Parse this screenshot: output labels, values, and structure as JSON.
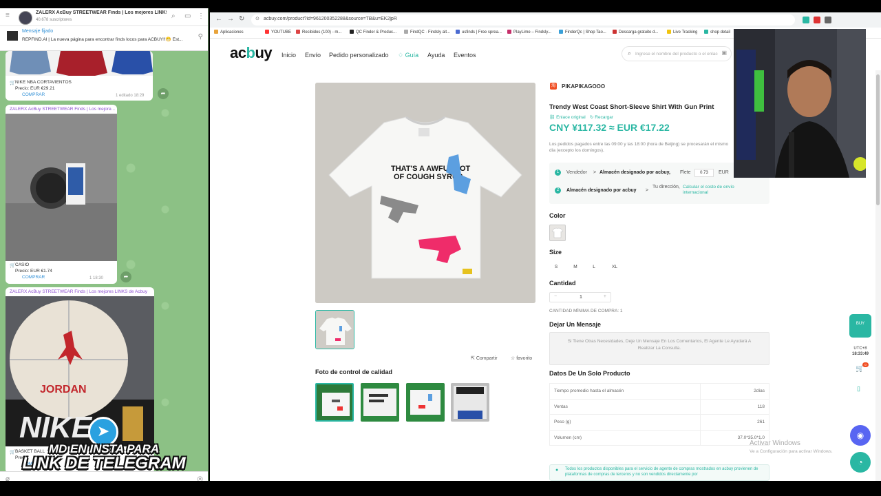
{
  "telegram": {
    "channel_title": "ZALERX AcBuy STREETWEAR Finds | Los mejores LINKS de Ac...",
    "subscribers": "40.678 suscriptores",
    "pinned_label": "Mensaje fijado",
    "pinned_text": "REPFIND.AI | La nueva página para encontrar finds locos para ACBUY!!😁 Est...",
    "msg1": {
      "icon": "🛒",
      "product": "NIKE NBA CORTAVIENTOS",
      "price": "Precio: EUR €29.21",
      "link": "COMPRAR",
      "meta": "1  editado 18:29"
    },
    "msg2": {
      "source": "ZALERX AcBuy STREETWEAR Finds | Los mejore...",
      "product": "CASIO",
      "price": "Precio: EUR €1.74",
      "link": "COMPRAR",
      "meta": "1  18:30"
    },
    "msg3": {
      "source": "ZALERX AcBuy STREETWEAR Finds | Los mejores LINKS de Acbuy",
      "product": "BASKET BALL",
      "price": "Precio:",
      "link": "COMPRAR"
    }
  },
  "overlay": {
    "line1": "MD EN INSTA PARA",
    "line2": "LINK DE TELEGRAM"
  },
  "browser": {
    "url": "acbuy.com/product?id=961200352288&source=TB&u=EK2jpR",
    "bookmarks": [
      "Aplicaciones",
      "YOUTUBE",
      "Recibidos (100) - m...",
      "QC Finder & Produc...",
      "FindQC · Findsly alt...",
      "usfinds | Free sprea...",
      "PlayLime – Findsly...",
      "FinderQc | Shop Tao...",
      "Descarga gratuito d...",
      "Live Tracking",
      "shop detail"
    ]
  },
  "site": {
    "logo_left": "ac",
    "logo_mid": "b",
    "logo_right": "uy",
    "nav": {
      "inicio": "Inicio",
      "envio": "Envío",
      "pedido": "Pedido personalizado",
      "guia": "Guía",
      "ayuda": "Ayuda",
      "eventos": "Eventos"
    },
    "search_placeholder": "Ingrese el nombre del producto o el enlace"
  },
  "product": {
    "seller_badge": "淘",
    "seller": "PIKAPIKAGOOO",
    "title": "Trendy West Coast Short-Sleeve Shirt With Gun Print",
    "original_link": "Enlace original",
    "reload": "Recargar",
    "price": "CNY ¥117.32  ≈  EUR €17.22",
    "hours_note": "Los pedidos pagados entre las 09:00 y las 18:00 (hora de Beijing) se procesarán el mismo día (excepto los domingos).",
    "steps": {
      "n1": "1",
      "vendedor": "Vendedor",
      "arrow": ">",
      "almacen1": "Almacén designado por acbuy,",
      "flete": "Flete",
      "flete_value": "0.73",
      "currency": "EUR",
      "n2": "2",
      "almacen2": "Almacén designado por acbuy",
      "tu_direccion": "Tu dirección,",
      "calc": "Calcular el costo de envío internacional"
    },
    "print_text": "THAT'S A AWFUL LOT OF COUGH SYRUP",
    "share": "Compartir",
    "favorite": "favorito",
    "qc_title": "Foto de control de calidad",
    "color_label": "Color",
    "size_label": "Size",
    "sizes": [
      "S",
      "M",
      "L",
      "XL"
    ],
    "qty_label": "Cantidad",
    "qty_minus": "−",
    "qty": "1",
    "qty_plus": "+",
    "min_qty": "CANTIDAD MÍNIMA DE COMPRA: 1",
    "message_label": "Dejar Un Mensaje",
    "message_placeholder": "Si Tiene Otras Necesidades, Deje Un Mensaje En Los Comentarios, El Agente Le Ayudará A Realizar La Consulta.",
    "data_label": "Datos De Un Solo Producto",
    "data_rows": [
      {
        "k": "Tiempo promedio hasta el almacén",
        "v": "2días"
      },
      {
        "k": "Ventas",
        "v": "118"
      },
      {
        "k": "Peso (g)",
        "v": "261"
      },
      {
        "k": "Volumen (cm)",
        "v": "37.0*35.0*1.0"
      }
    ],
    "notice": "Todos los productos disponibles para el servicio de agente de compras mostrados en acbuy provienen de plataformas de compras de terceros y no son vendidos directamente por"
  },
  "floating": {
    "buy": "BUY",
    "utc": "UTC+8",
    "time": "18:33:49",
    "cart_count": "0"
  },
  "windows": {
    "line1": "Activar Windows",
    "line2": "Ve a Configuración para activar Windows."
  },
  "colors": {
    "accent": "#2ab7a3",
    "price": "#2ab7a3",
    "telegram_bg": "#8cc185"
  }
}
